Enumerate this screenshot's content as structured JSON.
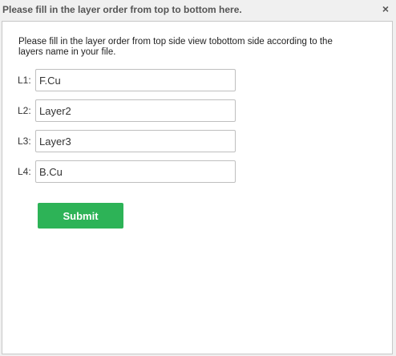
{
  "dialog": {
    "title": "Please fill in the layer order from top to bottom here.",
    "close_label": "×",
    "instructions": "Please fill in the layer order from top side view tobottom side according to the layers name in your file."
  },
  "layers": [
    {
      "label": "L1:",
      "value": "F.Cu"
    },
    {
      "label": "L2:",
      "value": "Layer2"
    },
    {
      "label": "L3:",
      "value": "Layer3"
    },
    {
      "label": "L4:",
      "value": "B.Cu"
    }
  ],
  "submit_label": "Submit",
  "colors": {
    "submit_button": "#2db357",
    "title_text": "#555555"
  }
}
